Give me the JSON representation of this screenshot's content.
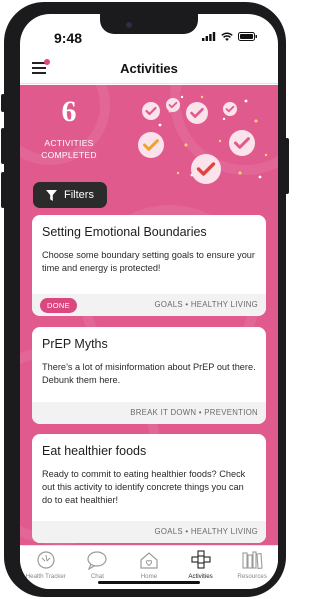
{
  "status_bar": {
    "time": "9:48"
  },
  "header": {
    "title": "Activities",
    "menu_icon": "hamburger-icon"
  },
  "summary": {
    "count": "6",
    "label": "ACTIVITIES\nCOMPLETED"
  },
  "filters": {
    "label": "Filters",
    "icon": "filter-icon"
  },
  "colors": {
    "accent": "#e05a8e",
    "done": "#d9487f",
    "dark_button": "#2b2b2b"
  },
  "activities": [
    {
      "title": "Setting Emotional Boundaries",
      "description": "Choose some boundary setting goals to ensure your time and energy is protected!",
      "status": "DONE",
      "tags": "GOALS • HEALTHY LIVING"
    },
    {
      "title": "PrEP Myths",
      "description": "There’s a lot of misinformation about PrEP out there. Debunk them here.",
      "tags": "BREAK IT DOWN • PREVENTION"
    },
    {
      "title": "Eat healthier foods",
      "description": "Ready to commit to eating healthier foods? Check out this activity to identify concrete things you can do to eat healthier!",
      "tags": "GOALS • HEALTHY LIVING"
    }
  ],
  "tab_bar": {
    "active": "Activities",
    "tabs": [
      {
        "label": "Health Tracker",
        "icon": "health-tracker-icon"
      },
      {
        "label": "Chat",
        "icon": "chat-icon"
      },
      {
        "label": "Home",
        "icon": "home-icon"
      },
      {
        "label": "Activities",
        "icon": "activities-icon"
      },
      {
        "label": "Resources",
        "icon": "resources-icon"
      }
    ]
  }
}
